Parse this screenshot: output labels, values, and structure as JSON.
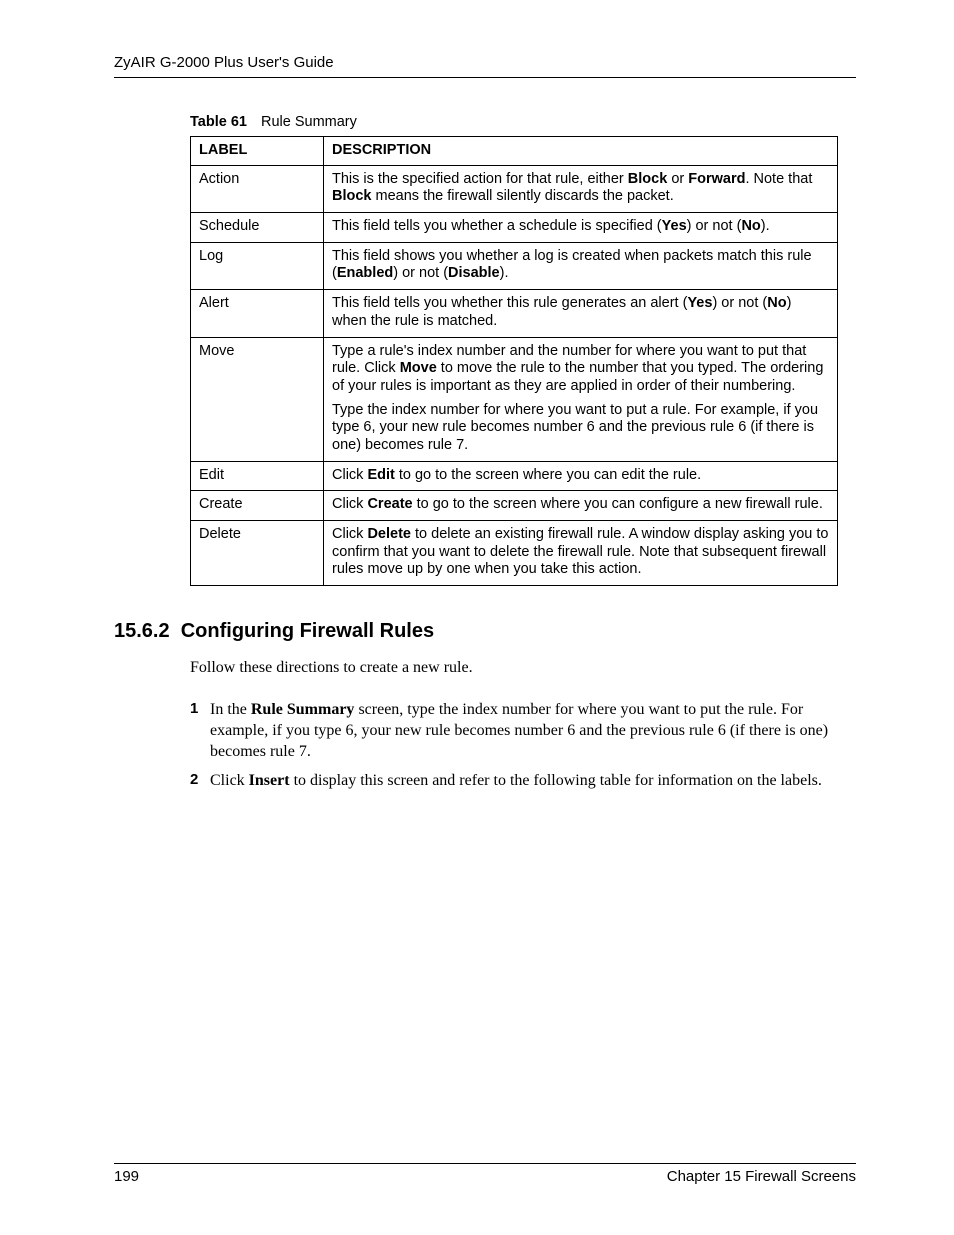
{
  "header": {
    "guide_title": "ZyAIR G-2000 Plus User's Guide"
  },
  "table_caption": {
    "label": "Table 61",
    "title": "Rule Summary"
  },
  "table": {
    "headers": {
      "col1": "LABEL",
      "col2": "DESCRIPTION"
    },
    "rows": [
      {
        "label": "Action",
        "desc_html": "This is the specified action for that rule, either <span class=\"b\">Block</span> or <span class=\"b\">Forward</span>. Note that <span class=\"b\">Block</span> means the firewall silently discards the packet."
      },
      {
        "label": "Schedule",
        "desc_html": "This field tells you whether a schedule is specified (<span class=\"b\">Yes</span>) or not (<span class=\"b\">No</span>)."
      },
      {
        "label": "Log",
        "desc_html": "This field shows you whether a log is created when packets match this rule (<span class=\"b\">Enabled</span>) or not (<span class=\"b\">Disable</span>)."
      },
      {
        "label": "Alert",
        "desc_html": "This field tells you whether this rule generates an alert (<span class=\"b\">Yes</span>) or not (<span class=\"b\">No</span>) when the rule is matched."
      },
      {
        "label": "Move",
        "desc_html": "<p>Type a rule's index number and the number for where you want to put that rule. Click <span class=\"b\">Move</span> to move the rule to the number that you typed. The ordering of your rules is important as they are applied in order of their numbering.</p><p>Type the index number for where you want to put a rule. For example, if you type 6, your new rule becomes number 6 and the previous rule 6 (if there is one) becomes rule 7.</p>",
        "multi": true
      },
      {
        "label": "Edit",
        "desc_html": "Click <span class=\"b\">Edit</span> to go to the screen where you can edit the rule."
      },
      {
        "label": "Create",
        "desc_html": "Click <span class=\"b\">Create</span> to go to the screen where you can configure a new firewall rule."
      },
      {
        "label": "Delete",
        "desc_html": "Click <span class=\"b\">Delete</span> to delete an existing firewall rule. A window display asking you to confirm that you want to delete the firewall rule. Note that subsequent firewall rules move up by one when you take this action."
      }
    ]
  },
  "section": {
    "number": "15.6.2",
    "title": "Configuring Firewall Rules"
  },
  "intro_text": "Follow these directions to create a new rule.",
  "steps": [
    {
      "num": "1",
      "html": "In the <span class=\"b\">Rule Summary</span> screen, type the index number for where you want to put the rule. For example, if you type 6, your new rule becomes number 6 and the previous rule 6 (if there is one) becomes rule 7."
    },
    {
      "num": "2",
      "html": "Click <span class=\"b\">Insert</span> to display this screen and refer to the following table for information on the labels."
    }
  ],
  "footer": {
    "page": "199",
    "chapter": "Chapter 15 Firewall Screens"
  }
}
